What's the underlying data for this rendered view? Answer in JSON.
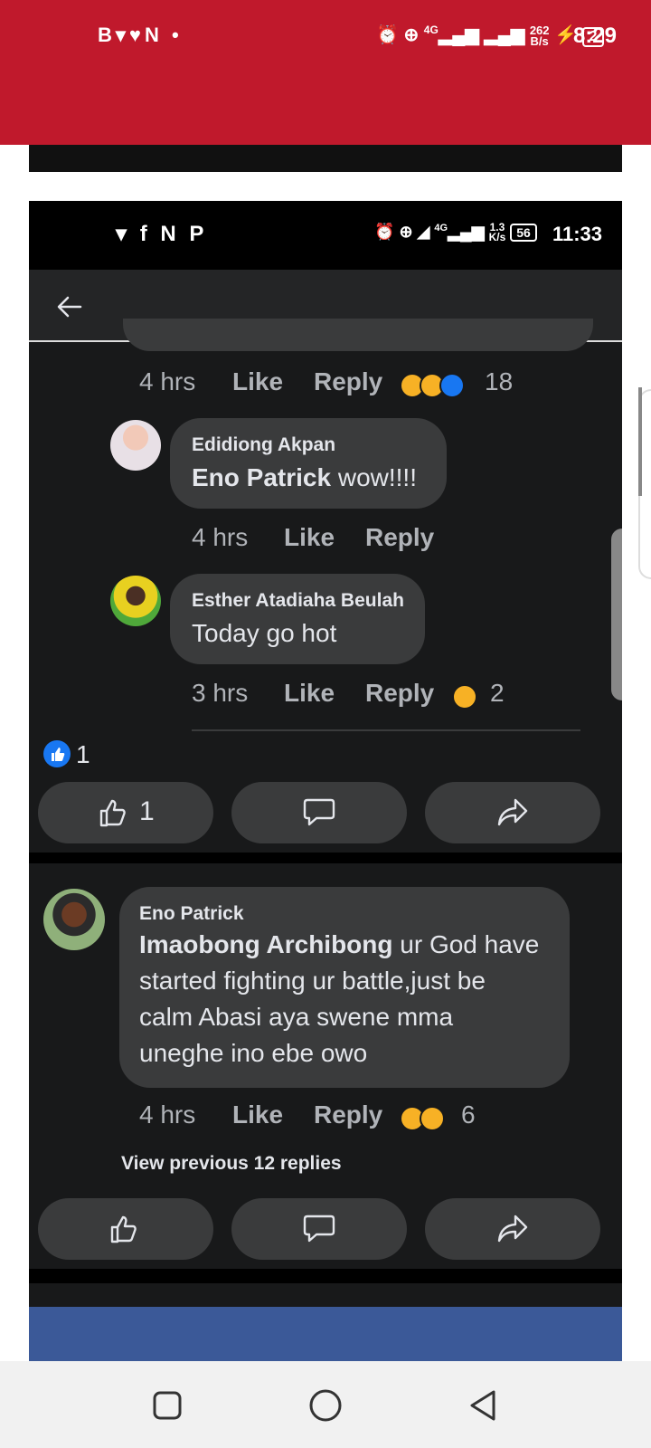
{
  "outer_status": {
    "left_icons": "B▾♥N •",
    "network": "4G",
    "speed_top": "262",
    "speed_bottom": "B/s",
    "battery": "2",
    "time": "8:29"
  },
  "inner_status": {
    "left_icons": "▾ f N P",
    "network": "4G",
    "speed_top": "1.3",
    "speed_bottom": "K/s",
    "battery": "56",
    "time": "11:33"
  },
  "thread": {
    "first_meta": {
      "time": "4 hrs",
      "like": "Like",
      "reply": "Reply",
      "count": "18"
    },
    "replies": [
      {
        "name": "Edidiong Akpan",
        "mention": "Eno Patrick",
        "text": " wow!!!!",
        "time": "4 hrs",
        "like": "Like",
        "reply": "Reply",
        "count": ""
      },
      {
        "name": "Esther Atadiaha Beulah",
        "mention": "",
        "text": "Today go hot",
        "time": "3 hrs",
        "like": "Like",
        "reply": "Reply",
        "count": "2"
      }
    ],
    "post_like_count": "1",
    "action_like_count": "1"
  },
  "comment": {
    "name": "Eno Patrick",
    "mention": "Imaobong Archibong",
    "text_lines": [
      " ur God have",
      "started fighting ur battle,just be",
      "calm Abasi aya swene mma",
      "uneghe ino ebe owo"
    ],
    "time": "4 hrs",
    "like": "Like",
    "reply": "Reply",
    "count": "6",
    "view_previous": "View previous 12 replies"
  },
  "colors": {
    "brand_red": "#c0192c",
    "fb_dark_bg": "#18191a",
    "bubble": "#3a3b3c",
    "fb_blue": "#1877f2",
    "haha_yellow": "#f7b125"
  }
}
